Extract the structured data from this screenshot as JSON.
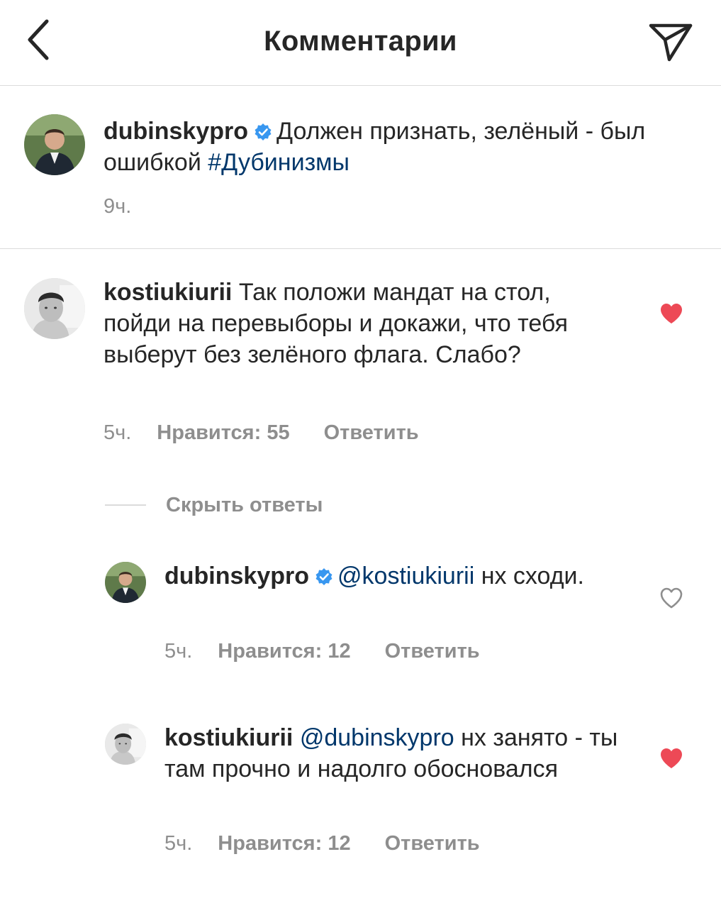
{
  "header": {
    "title": "Комментарии",
    "back_icon": "chevron-left-icon",
    "share_icon": "paper-plane-icon"
  },
  "caption": {
    "username": "dubinskypro",
    "text": "Должен признать, зелёный - был ошибкой ",
    "hashtag": "#Дубинизмы",
    "time": "9ч."
  },
  "comment": {
    "username": "kostiukiurii",
    "text": "Так положи мандат на стол,  пойди на перевыборы и докажи, что тебя выберут без зелёного флага. Слабо?",
    "time": "5ч.",
    "likes": "Нравится: 55",
    "reply": "Ответить",
    "liked": true
  },
  "hide_replies": "Скрыть ответы",
  "replies": [
    {
      "username": "dubinskypro",
      "mention": "@kostiukiurii",
      "text": " нх сходи.",
      "time": "5ч.",
      "likes": "Нравится: 12",
      "reply": "Ответить",
      "liked": false
    },
    {
      "username": "kostiukiurii",
      "mention": "@dubinskypro",
      "text": " нх занято - ты там прочно и надолго обосновался",
      "time": "5ч.",
      "likes": "Нравится: 12",
      "reply": "Ответить",
      "liked": true
    }
  ],
  "colors": {
    "text": "#262626",
    "secondary": "#8e8e8e",
    "link": "#00376b",
    "verified": "#3897f0",
    "heart": "#ed4956",
    "divider": "#dbdbdb"
  }
}
